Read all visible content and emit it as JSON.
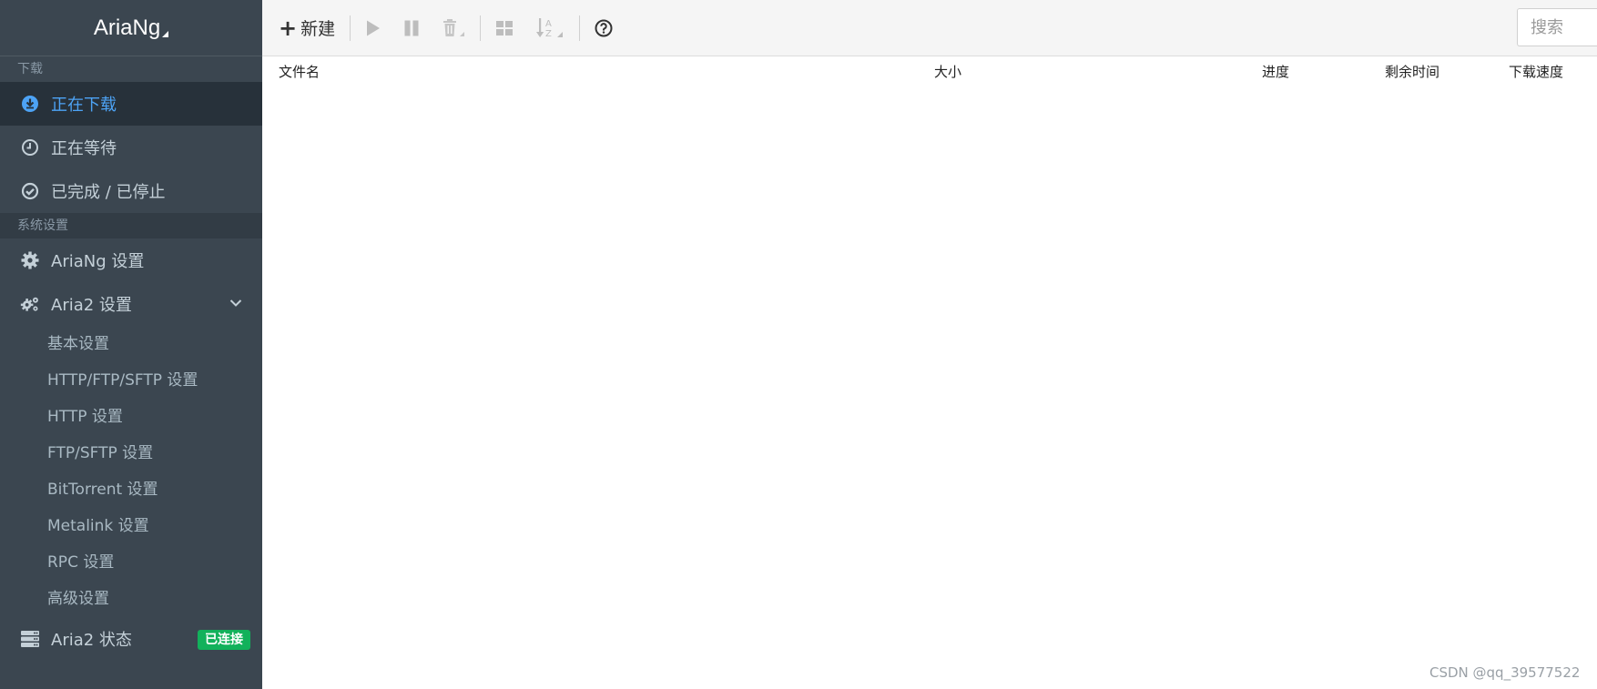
{
  "brand": {
    "name": "AriaNg"
  },
  "sidebar": {
    "section_download": "下载",
    "downloading": "正在下载",
    "waiting": "正在等待",
    "stopped": "已完成 / 已停止",
    "section_settings": "系统设置",
    "ariang_settings": "AriaNg 设置",
    "aria2_settings": "Aria2 设置",
    "aria2_sub": [
      "基本设置",
      "HTTP/FTP/SFTP 设置",
      "HTTP 设置",
      "FTP/SFTP 设置",
      "BitTorrent 设置",
      "Metalink 设置",
      "RPC 设置",
      "高级设置"
    ],
    "aria2_status": "Aria2 状态",
    "status_badge": "已连接"
  },
  "toolbar": {
    "new_label": "新建",
    "search_placeholder": "搜索"
  },
  "table": {
    "columns": [
      "文件名",
      "大小",
      "进度",
      "剩余时间",
      "下载速度"
    ]
  },
  "watermark": "CSDN @qq_39577522",
  "colors": {
    "sidebar_bg": "#3b4650",
    "active_item": "#4da3f5",
    "badge_green": "#12b15b"
  }
}
